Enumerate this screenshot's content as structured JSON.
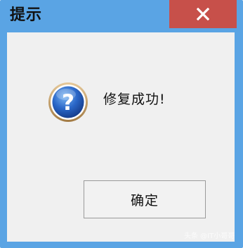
{
  "window": {
    "title": "提示",
    "close_icon": "close-icon",
    "close_color": "#c7504a",
    "frame_color": "#5aa4e4"
  },
  "content": {
    "icon": "question-icon",
    "message": "修复成功!"
  },
  "buttons": {
    "ok_label": "确定"
  },
  "watermark": {
    "text": "头条 @IT小哥哥"
  }
}
